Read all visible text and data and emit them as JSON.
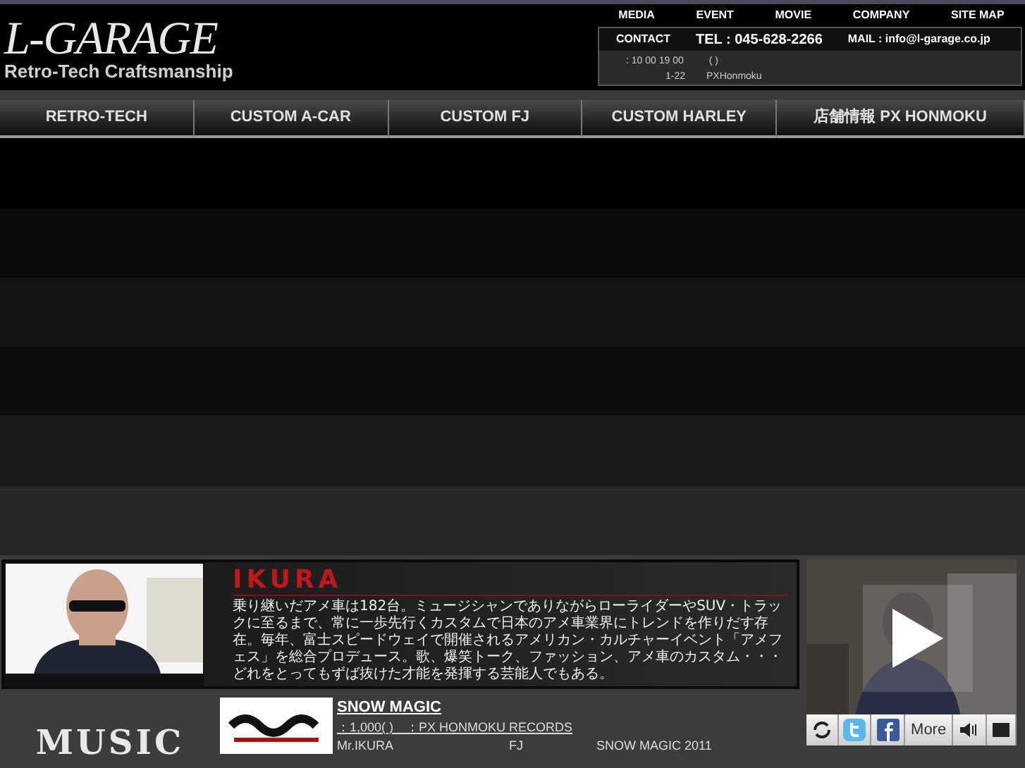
{
  "header": {
    "logo": "L-GARAGE",
    "tagline": "Retro-Tech Craftsmanship",
    "top_links": [
      "MEDIA",
      "EVENT",
      "MOVIE",
      "COMPANY",
      "SITE MAP"
    ],
    "contact": {
      "label": "CONTACT",
      "tel": "TEL : 045-628-2266",
      "mail": "MAIL : info@l-garage.co.jp",
      "hours": ": 10 00 19 00",
      "paren": "(            )",
      "address": "1-22",
      "place": "PXHonmoku"
    }
  },
  "nav": [
    {
      "label": "RETRO-TECH"
    },
    {
      "label": "CUSTOM A-CAR"
    },
    {
      "label": "CUSTOM  FJ"
    },
    {
      "label": "CUSTOM HARLEY"
    },
    {
      "label": "店舗情報  PX  HONMOKU"
    }
  ],
  "profile": {
    "name": "IKURA",
    "bio": "乗り継いだアメ車は182台。ミュージシャンでありながらローライダーやSUV・トラックに至るまで、常に一歩先行くカスタムで日本のアメ車業界にトレンドを作りだす存在。毎年、富士スピードウェイで開催されるアメリカン・カルチャーイベント「アメフェス」を総合プロデュース。歌、爆笑トーク、ファッション、アメ車のカスタム・・・どれをとってもずば抜けた才能を発揮する芸能人でもある。"
  },
  "music": {
    "heading": "MUSIC",
    "title": "SNOW MAGIC",
    "meta": "：1,000(  )　：PX HONMOKU RECORDS",
    "col_1": "Mr.IKURA",
    "col_2": "FJ",
    "col_3": "SNOW MAGIC  2011"
  },
  "player": {
    "controls": [
      {
        "kind": "refresh"
      },
      {
        "kind": "twitter"
      },
      {
        "kind": "facebook"
      },
      {
        "kind": "text",
        "label": "More"
      },
      {
        "kind": "volume"
      },
      {
        "kind": "fullscreen"
      }
    ]
  }
}
